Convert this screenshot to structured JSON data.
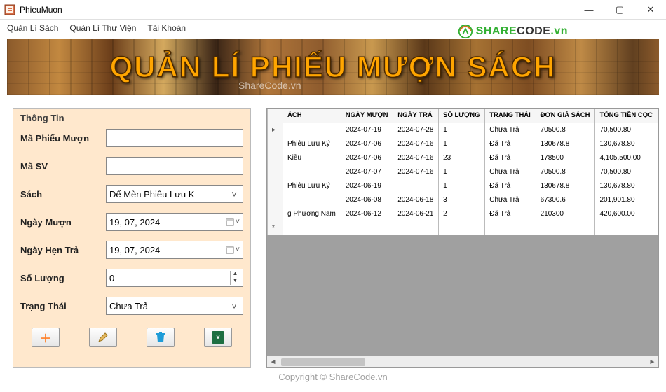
{
  "window": {
    "title": "PhieuMuon",
    "minimize": "—",
    "maximize": "▢",
    "close": "✕"
  },
  "logo": {
    "share": "SHARE",
    "code": "CODE",
    "vn": ".vn"
  },
  "menu": {
    "items": [
      "Quản Lí Sách",
      "Quản Lí Thư Viện",
      "Tài Khoản"
    ]
  },
  "banner": {
    "title": "QUẢN LÍ PHIẾU MƯỢN SÁCH"
  },
  "watermarks": {
    "small": "ShareCode.vn",
    "copyright": "Copyright © ShareCode.vn"
  },
  "form": {
    "legend": "Thông Tin",
    "labels": {
      "maphieu": "Mã Phiếu Mượn",
      "masv": "Mã SV",
      "sach": "Sách",
      "ngaymuon": "Ngày Mượn",
      "ngayhentra": "Ngày Hẹn Trả",
      "soluong": "Số Lượng",
      "trangthai": "Trạng Thái"
    },
    "values": {
      "maphieu": "",
      "masv": "",
      "sach": "Dế Mèn Phiêu Lưu K",
      "ngaymuon": "19, 07, 2024",
      "ngayhentra": "19, 07, 2024",
      "soluong": "0",
      "trangthai": "Chưa Trả"
    }
  },
  "grid": {
    "headers": {
      "rowhead": "",
      "sach": "ÁCH",
      "ngaymuon": "NGÀY MƯỢN",
      "ngaytra": "NGÀY TRẢ",
      "soluong": "SỐ LƯỢNG",
      "trangthai": "TRẠNG THÁI",
      "dongia": "ĐƠN GIÁ SÁCH",
      "tong": "TỔNG TIỀN CỌC"
    },
    "rows": [
      {
        "selected": true,
        "sach": "",
        "ngaymuon": "2024-07-19",
        "ngaytra": "2024-07-28",
        "soluong": "1",
        "trangthai": "Chưa Trả",
        "dongia": "70500.8",
        "tong": "70,500.80"
      },
      {
        "selected": false,
        "sach": "Phiêu Lưu Ký",
        "ngaymuon": "2024-07-06",
        "ngaytra": "2024-07-16",
        "soluong": "1",
        "trangthai": "Đã Trả",
        "dongia": "130678.8",
        "tong": "130,678.80"
      },
      {
        "selected": false,
        "sach": "Kiều",
        "ngaymuon": "2024-07-06",
        "ngaytra": "2024-07-16",
        "soluong": "23",
        "trangthai": "Đã Trả",
        "dongia": "178500",
        "tong": "4,105,500.00"
      },
      {
        "selected": false,
        "sach": "",
        "ngaymuon": "2024-07-07",
        "ngaytra": "2024-07-16",
        "soluong": "1",
        "trangthai": "Chưa Trả",
        "dongia": "70500.8",
        "tong": "70,500.80"
      },
      {
        "selected": false,
        "sach": "Phiêu Lưu Ký",
        "ngaymuon": "2024-06-19",
        "ngaytra": "",
        "soluong": "1",
        "trangthai": "Đã Trả",
        "dongia": "130678.8",
        "tong": "130,678.80"
      },
      {
        "selected": false,
        "sach": "",
        "ngaymuon": "2024-06-08",
        "ngaytra": "2024-06-18",
        "soluong": "3",
        "trangthai": "Chưa Trả",
        "dongia": "67300.6",
        "tong": "201,901.80"
      },
      {
        "selected": false,
        "sach": "g Phương Nam",
        "ngaymuon": "2024-06-12",
        "ngaytra": "2024-06-21",
        "soluong": "2",
        "trangthai": "Đã Trả",
        "dongia": "210300",
        "tong": "420,600.00"
      }
    ]
  }
}
